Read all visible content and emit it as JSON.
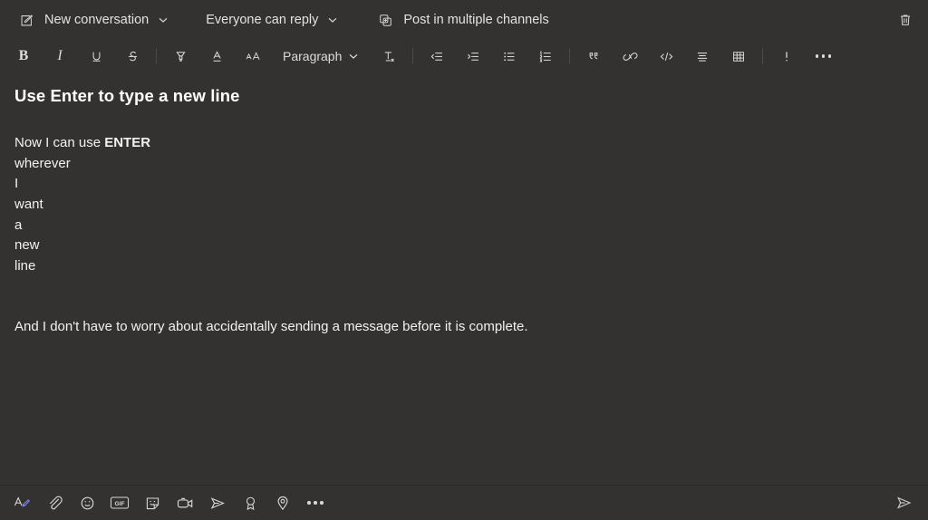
{
  "window": {
    "app": "Microsoft Teams message compose",
    "theme": "dark",
    "colors": {
      "background": "#343231",
      "text": "#f3f2f1",
      "icon": "#d9d7d5",
      "separator": "#4c4a48",
      "accent": "#7b83eb"
    }
  },
  "options_bar": {
    "new_conversation": {
      "label": "New conversation",
      "icon": "compose-icon",
      "chevron": "chevron-down-icon"
    },
    "reply_scope": {
      "label": "Everyone can reply",
      "chevron": "chevron-down-icon"
    },
    "multi_channel": {
      "label": "Post in multiple channels",
      "icon": "multiple-channels-icon"
    },
    "delete": {
      "label": "Delete",
      "icon": "trash-icon"
    }
  },
  "format_toolbar": {
    "items": [
      {
        "name": "bold",
        "label": "B",
        "icon": "bold-icon"
      },
      {
        "name": "italic",
        "label": "I",
        "icon": "italic-icon"
      },
      {
        "name": "underline",
        "label": "U",
        "icon": "underline-icon"
      },
      {
        "name": "strikethrough",
        "label": "S",
        "icon": "strikethrough-icon"
      },
      {
        "name": "highlight",
        "label": "Highlight",
        "icon": "highlighter-icon"
      },
      {
        "name": "font-color",
        "label": "Font color",
        "icon": "font-color-icon"
      },
      {
        "name": "font-size",
        "label": "Font size",
        "icon": "font-size-icon"
      },
      {
        "name": "paragraph",
        "label": "Paragraph",
        "icon": "chevron-down-icon"
      },
      {
        "name": "clear-formatting",
        "label": "Clear formatting",
        "icon": "clear-formatting-icon"
      },
      {
        "name": "decrease-indent",
        "label": "Decrease indent",
        "icon": "decrease-indent-icon"
      },
      {
        "name": "increase-indent",
        "label": "Increase indent",
        "icon": "increase-indent-icon"
      },
      {
        "name": "bulleted-list",
        "label": "Bulleted list",
        "icon": "bulleted-list-icon"
      },
      {
        "name": "numbered-list",
        "label": "Numbered list",
        "icon": "numbered-list-icon"
      },
      {
        "name": "quote",
        "label": "Quote",
        "icon": "quote-icon"
      },
      {
        "name": "insert-link",
        "label": "Insert link",
        "icon": "link-icon"
      },
      {
        "name": "code-snippet",
        "label": "Code snippet",
        "icon": "code-icon"
      },
      {
        "name": "paragraph-align",
        "label": "Align",
        "icon": "align-icon"
      },
      {
        "name": "insert-table",
        "label": "Insert table",
        "icon": "table-icon"
      },
      {
        "name": "mark-important",
        "label": "!",
        "icon": "important-icon"
      },
      {
        "name": "more-format-options",
        "label": "More options",
        "icon": "more-horizontal-icon"
      }
    ],
    "paragraph_label": "Paragraph"
  },
  "compose": {
    "subject": "Use Enter to type a new line",
    "body_lines": [
      {
        "text": "Now I can use ",
        "bold_suffix": "ENTER"
      },
      {
        "text": "wherever"
      },
      {
        "text": "I"
      },
      {
        "text": "want"
      },
      {
        "text": "a"
      },
      {
        "text": "new"
      },
      {
        "text": "line"
      }
    ],
    "closing_paragraph": "And I don't have to worry about accidentally sending a message before it is complete."
  },
  "bottom_toolbar": {
    "items": [
      {
        "name": "format",
        "label": "Format",
        "icon": "format-pen-icon"
      },
      {
        "name": "attach",
        "label": "Attach",
        "icon": "paperclip-icon"
      },
      {
        "name": "emoji",
        "label": "Emoji",
        "icon": "emoji-icon"
      },
      {
        "name": "giphy",
        "label": "GIF",
        "icon": "gif-icon"
      },
      {
        "name": "sticker",
        "label": "Sticker",
        "icon": "sticker-icon"
      },
      {
        "name": "meet-now",
        "label": "Meet now",
        "icon": "video-icon"
      },
      {
        "name": "stream",
        "label": "Stream",
        "icon": "stream-icon"
      },
      {
        "name": "praise",
        "label": "Praise",
        "icon": "praise-icon"
      },
      {
        "name": "location",
        "label": "Location",
        "icon": "location-pin-icon"
      },
      {
        "name": "more-options",
        "label": "More options",
        "icon": "more-horizontal-icon"
      }
    ],
    "send": {
      "label": "Send",
      "icon": "send-icon"
    }
  }
}
